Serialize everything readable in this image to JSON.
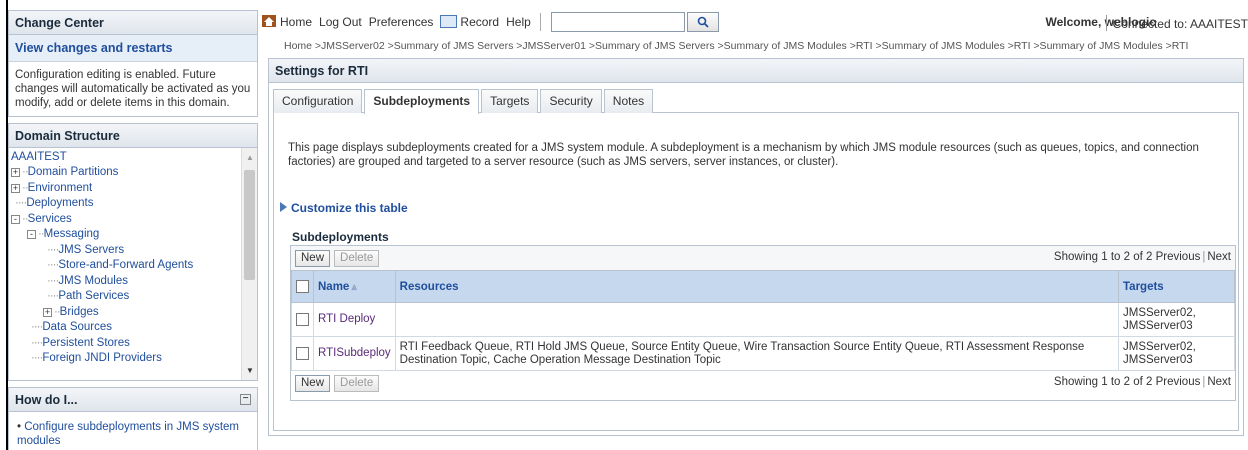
{
  "page_caption": "Settings for RTI",
  "change_center": {
    "title": "Change Center",
    "link": "View changes and restarts",
    "text": "Configuration editing is enabled. Future changes will automatically be activated as you modify, add or delete items in this domain."
  },
  "domain_structure": {
    "title": "Domain Structure",
    "nodes": [
      {
        "label": "AAAITEST"
      },
      {
        "label": "Domain Partitions",
        "expander": "+"
      },
      {
        "label": "Environment",
        "expander": "+"
      },
      {
        "label": "Deployments"
      },
      {
        "label": "Services",
        "expander": "-"
      },
      {
        "label": "Messaging",
        "expander": "-"
      },
      {
        "label": "JMS Servers"
      },
      {
        "label": "Store-and-Forward Agents"
      },
      {
        "label": "JMS Modules"
      },
      {
        "label": "Path Services"
      },
      {
        "label": "Bridges",
        "expander": "+"
      },
      {
        "label": "Data Sources"
      },
      {
        "label": "Persistent Stores"
      },
      {
        "label": "Foreign JNDI Providers"
      }
    ]
  },
  "how_do_i": {
    "title": "How do I...",
    "items": [
      "Configure subdeployments in JMS system modules"
    ]
  },
  "header": {
    "home": "Home",
    "logout": "Log Out",
    "preferences": "Preferences",
    "record": "Record",
    "help": "Help",
    "search_value": "",
    "welcome": "Welcome, weblogic",
    "connected": "Connected to: AAAITEST"
  },
  "breadcrumb": "Home >JMSServer02 >Summary of JMS Servers >JMSServer01 >Summary of JMS Servers >Summary of JMS Modules >RTI >Summary of JMS Modules >RTI >Summary of JMS Modules >RTI",
  "settings": {
    "title": "Settings for RTI",
    "tabs": [
      "Configuration",
      "Subdeployments",
      "Targets",
      "Security",
      "Notes"
    ],
    "active_tab": "Subdeployments",
    "description": "This page displays subdeployments created for a JMS system module. A subdeployment is a mechanism by which JMS module resources (such as queues, topics, and connection factories) are grouped and targeted to a server resource (such as JMS servers, server instances, or cluster).",
    "customize": "Customize this table",
    "table_title": "Subdeployments",
    "new_label": "New",
    "delete_label": "Delete",
    "paging": {
      "showing": "Showing 1 to 2 of 2",
      "previous": "Previous",
      "next": "Next"
    },
    "columns": [
      "Name",
      "Resources",
      "Targets"
    ],
    "rows": [
      {
        "name": "RTI Deploy",
        "resources": "",
        "targets": [
          "JMSServer02,",
          "JMSServer03"
        ]
      },
      {
        "name": "RTISubdeploy",
        "resources": "RTI Feedback Queue, RTI Hold JMS Queue, Source Entity Queue, Wire Transaction Source Entity Queue, RTI Assessment Response Destination Topic, Cache Operation Message Destination Topic",
        "targets": [
          "JMSServer02,",
          "JMSServer03"
        ]
      }
    ]
  }
}
